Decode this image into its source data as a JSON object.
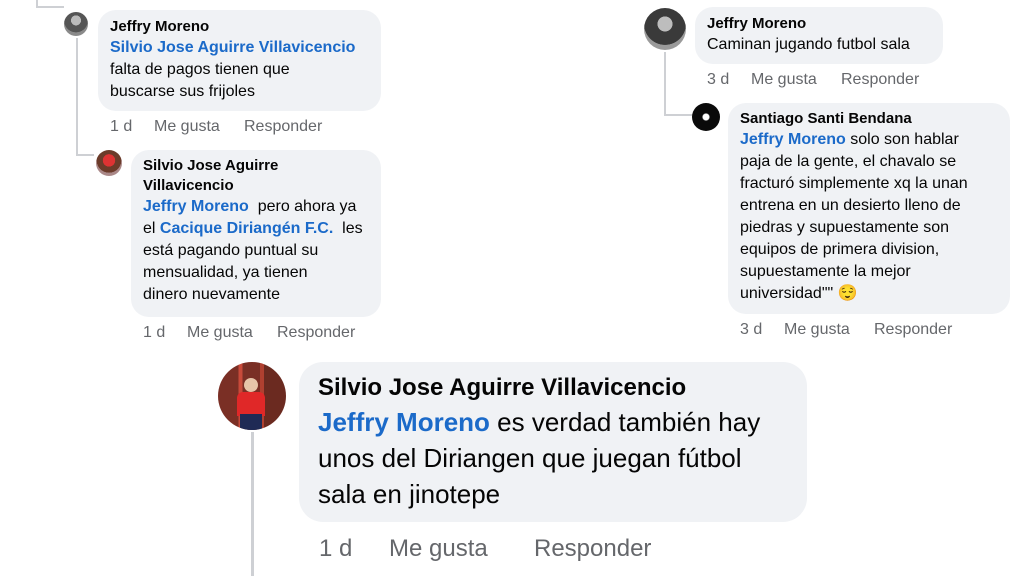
{
  "comments": [
    {
      "author": "Jeffry Moreno",
      "mention": "Silvio Jose Aguirre Villavicencio",
      "lines": [
        "falta de pagos tienen que",
        "buscarse sus frijoles"
      ],
      "time": "1 d",
      "like": "Me gusta",
      "reply": "Responder"
    },
    {
      "author_lines": [
        "Silvio Jose Aguirre",
        "Villavicencio"
      ],
      "mention": "Jeffry Moreno",
      "line1_after": "pero ahora ya",
      "line2_before": "el",
      "mention2": "Cacique Diriangén F.C.",
      "line2_after": "les",
      "lines": [
        "está pagando puntual su",
        "mensualidad, ya tienen",
        "dinero nuevamente"
      ],
      "time": "1 d",
      "like": "Me gusta",
      "reply": "Responder"
    },
    {
      "author": "Jeffry Moreno",
      "text": "Caminan jugando futbol sala",
      "time": "3 d",
      "like": "Me gusta",
      "reply": "Responder"
    },
    {
      "author": "Santiago Santi Bendana",
      "mention": "Jeffry Moreno",
      "line1_after": "solo son hablar",
      "lines": [
        "paja de la gente, el chavalo se",
        "fracturó simplemente xq la unan",
        "entrena en un desierto lleno de",
        "piedras y supuestamente son",
        "equipos de primera division,",
        "supuestamente la mejor"
      ],
      "last_line": "universidad\"\"",
      "emoji": "😌",
      "time": "3 d",
      "like": "Me gusta",
      "reply": "Responder"
    },
    {
      "author": "Silvio Jose Aguirre Villavicencio",
      "mention": "Jeffry Moreno",
      "line1_after": "es verdad también hay",
      "lines": [
        "unos del Diriangen que juegan fútbol",
        "sala  en jinotepe"
      ],
      "time": "1 d",
      "like": "Me gusta",
      "reply": "Responder"
    }
  ],
  "colors": {
    "bubble": "#f0f2f5",
    "mention": "#1b6ac9",
    "meta": "#65676b",
    "thread_line": "#ced0d4"
  }
}
